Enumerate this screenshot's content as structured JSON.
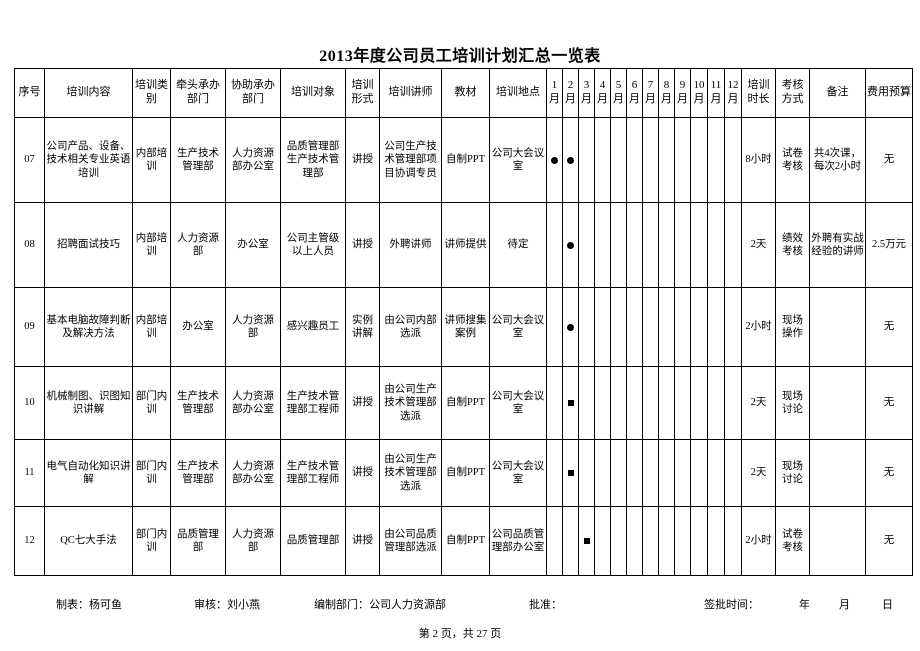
{
  "document": {
    "title": "2013年度公司员工培训计划汇总一览表",
    "page_label": "第 2 页，共 27 页"
  },
  "table": {
    "headers": {
      "seq": "序号",
      "content": "培训内容",
      "category": "培训类别",
      "lead_dept": "牵头承办部门",
      "assist_dept": "协助承办部门",
      "audience": "培训对象",
      "form": "培训形式",
      "trainer": "培训讲师",
      "material": "教材",
      "place": "培训地点",
      "months": [
        "1月",
        "2月",
        "3月",
        "4月",
        "5月",
        "6月",
        "7月",
        "8月",
        "9月",
        "10月",
        "11月",
        "12月"
      ],
      "duration": "培训时长",
      "assessment": "考核方式",
      "remark": "备注",
      "budget": "费用预算"
    },
    "marks": {
      "dot": "●",
      "square": "■"
    },
    "rows": [
      {
        "seq": "07",
        "content": "公司产品、设备、技术相关专业英语培训",
        "category": "内部培训",
        "lead_dept": "生产技术管理部",
        "assist_dept": "人力资源部办公室",
        "audience": "品质管理部生产技术管理部",
        "form": "讲授",
        "trainer": "公司生产技术管理部项目协调专员",
        "material": "自制PPT",
        "place": "公司大会议室",
        "months": [
          "●",
          "●",
          "",
          "",
          "",
          "",
          "",
          "",
          "",
          "",
          "",
          ""
        ],
        "duration": "8小时",
        "assessment": "试卷考核",
        "remark": "共4次课，每次2小时",
        "budget": "无"
      },
      {
        "seq": "08",
        "content": "招聘面试技巧",
        "category": "内部培训",
        "lead_dept": "人力资源部",
        "assist_dept": "办公室",
        "audience": "公司主管级以上人员",
        "form": "讲授",
        "trainer": "外聘讲师",
        "material": "讲师提供",
        "place": "待定",
        "months": [
          "",
          "●",
          "",
          "",
          "",
          "",
          "",
          "",
          "",
          "",
          "",
          ""
        ],
        "duration": "2天",
        "assessment": "绩效考核",
        "remark": "外聘有实战经验的讲师",
        "budget": "2.5万元"
      },
      {
        "seq": "09",
        "content": "基本电脑故障判断及解决方法",
        "category": "内部培训",
        "lead_dept": "办公室",
        "assist_dept": "人力资源部",
        "audience": "感兴趣员工",
        "form": "实例讲解",
        "trainer": "由公司内部选派",
        "material": "讲师搜集案例",
        "place": "公司大会议室",
        "months": [
          "",
          "●",
          "",
          "",
          "",
          "",
          "",
          "",
          "",
          "",
          "",
          ""
        ],
        "duration": "2小时",
        "assessment": "现场操作",
        "remark": "",
        "budget": "无"
      },
      {
        "seq": "10",
        "content": "机械制图、识图知识讲解",
        "category": "部门内训",
        "lead_dept": "生产技术管理部",
        "assist_dept": "人力资源部办公室",
        "audience": "生产技术管理部工程师",
        "form": "讲授",
        "trainer": "由公司生产技术管理部选派",
        "material": "自制PPT",
        "place": "公司大会议室",
        "months": [
          "",
          "■",
          "",
          "",
          "",
          "",
          "",
          "",
          "",
          "",
          "",
          ""
        ],
        "duration": "2天",
        "assessment": "现场讨论",
        "remark": "",
        "budget": "无"
      },
      {
        "seq": "11",
        "content": "电气自动化知识讲解",
        "category": "部门内训",
        "lead_dept": "生产技术管理部",
        "assist_dept": "人力资源部办公室",
        "audience": "生产技术管理部工程师",
        "form": "讲授",
        "trainer": "由公司生产技术管理部选派",
        "material": "自制PPT",
        "place": "公司大会议室",
        "months": [
          "",
          "■",
          "",
          "",
          "",
          "",
          "",
          "",
          "",
          "",
          "",
          ""
        ],
        "duration": "2天",
        "assessment": "现场讨论",
        "remark": "",
        "budget": "无"
      },
      {
        "seq": "12",
        "content": "QC七大手法",
        "category": "部门内训",
        "lead_dept": "品质管理部",
        "assist_dept": "人力资源部",
        "audience": "品质管理部",
        "form": "讲授",
        "trainer": "由公司品质管理部选派",
        "material": "自制PPT",
        "place": "公司品质管理部办公室",
        "months": [
          "",
          "",
          "■",
          "",
          "",
          "",
          "",
          "",
          "",
          "",
          "",
          ""
        ],
        "duration": "2小时",
        "assessment": "试卷考核",
        "remark": "",
        "budget": "无"
      }
    ]
  },
  "footer": {
    "maker": "制表：杨可鱼",
    "reviewer": "审核：刘小燕",
    "compiling_dept": "编制部门：公司人力资源部",
    "approval": "批准：",
    "sign_time": "签批时间：",
    "year": "年",
    "month": "月",
    "day": "日"
  }
}
